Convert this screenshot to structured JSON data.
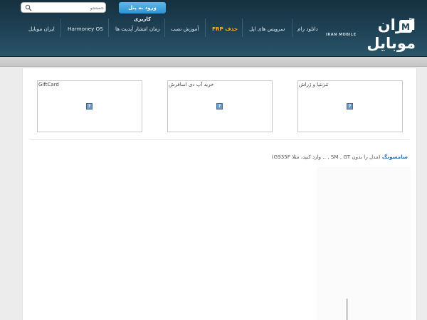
{
  "header": {
    "search": {
      "placeholder": "جستجو"
    },
    "login_label": "ورود به پنل کاربری",
    "nav": [
      {
        "label": "ایران موبایل"
      },
      {
        "label": "Harmoney OS"
      },
      {
        "label": "زمان انتشار آپدیت ها"
      },
      {
        "label": "آموزش نصب"
      },
      {
        "label": "حذف FRP",
        "highlight": true
      },
      {
        "label": "سرویس های اپل"
      },
      {
        "label": "دانلود رام"
      }
    ],
    "logo": {
      "text": "ایران موبایل",
      "sub": "IRAN MOBILE"
    }
  },
  "banners": [
    {
      "title": "GiftCard"
    },
    {
      "title": "خرید آپ دی اسافرش"
    },
    {
      "title": "تنزنتیا و ژراش"
    }
  ],
  "hint": {
    "brand": "سامسونگ",
    "text": " (مدل را بدون SM , GT , .. وارد کنید، مثلا G935F)"
  },
  "colors": {
    "header": "#1f4356",
    "accent": "#2f93d2",
    "highlight": "#f3b53a"
  }
}
